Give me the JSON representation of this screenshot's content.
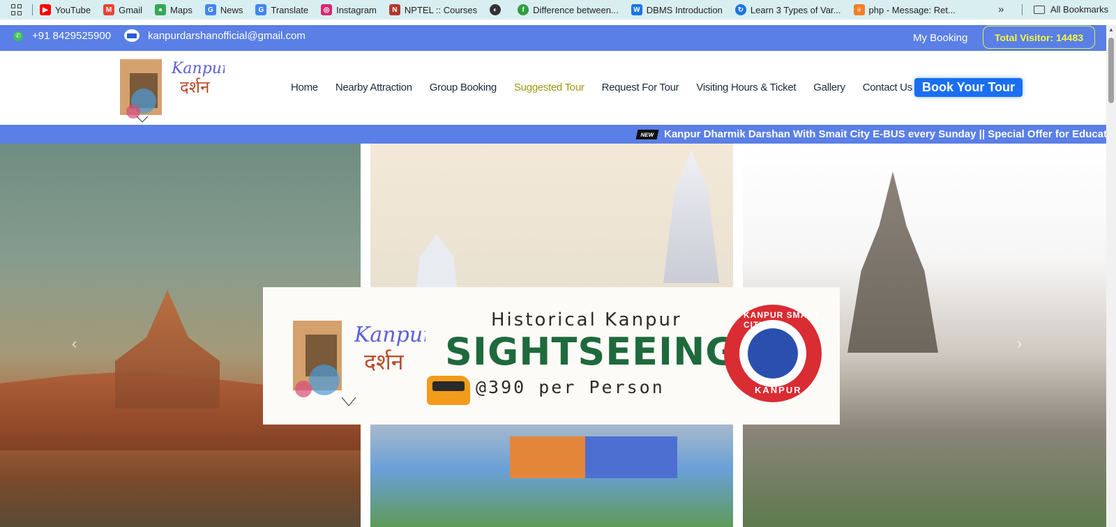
{
  "bookmarks": {
    "items": [
      {
        "label": "YouTube",
        "color": "#ff0000"
      },
      {
        "label": "Gmail",
        "color": "#ea4335"
      },
      {
        "label": "Maps",
        "color": "#34a853"
      },
      {
        "label": "News",
        "color": "#4285f4"
      },
      {
        "label": "Translate",
        "color": "#4285f4"
      },
      {
        "label": "Instagram",
        "color": "#d62976"
      },
      {
        "label": "NPTEL :: Courses",
        "color": "#b03a2e"
      },
      {
        "label": "",
        "color": "#333333"
      },
      {
        "label": "Difference between...",
        "color": "#2e9e3e"
      },
      {
        "label": "DBMS Introduction",
        "color": "#1a73e8"
      },
      {
        "label": "Learn 3 Types of Var...",
        "color": "#1a73e8"
      },
      {
        "label": "php - Message: Ret...",
        "color": "#f48024"
      }
    ],
    "more": "»",
    "all_label": "All Bookmarks"
  },
  "topbar": {
    "phone": "+91 8429525900",
    "email": "kanpurdarshanofficial@gmail.com",
    "my_booking": "My Booking",
    "visitor": "Total Visitor: 14483"
  },
  "nav": {
    "items": [
      "Home",
      "Nearby Attraction",
      "Group Booking",
      "Suggested Tour",
      "Request For Tour",
      "Visiting Hours & Ticket",
      "Gallery",
      "Contact Us"
    ],
    "active": "Suggested Tour",
    "book_label": "Book Your Tour"
  },
  "ticker": {
    "badge": "NEW",
    "text": "Kanpur Dharmik Darshan With Smait City E-BUS every Sunday || Special Offer for Educatio"
  },
  "banner": {
    "title": "Historical Kanpur",
    "main": "SIGHTSEEING",
    "price": "@390 per Person",
    "seal_top": "KANPUR SMART CITY LTD",
    "seal_bottom": "KANPUR"
  },
  "slider": {
    "prev": "‹",
    "next": "›"
  },
  "colors": {
    "topbar_bg": "#5a7fe6",
    "visitor_yellow": "#f5f83c",
    "book_btn": "#1a6ff0",
    "active_nav": "#9a9a12",
    "banner_green": "#1e6a3c"
  }
}
